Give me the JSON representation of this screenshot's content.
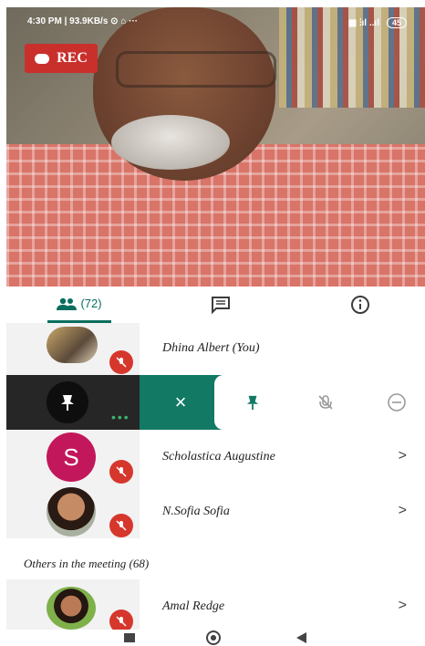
{
  "status_bar": {
    "left": "4:30 PM | 93.9KB/s ⊙ ⌂ ···",
    "right_signal": "▦ ⫶ıl ..ıl",
    "battery": "45"
  },
  "recording": {
    "label": "REC",
    "color": "#c9302c"
  },
  "tabs": {
    "people_count": "(72)",
    "chat_icon": "chat-icon",
    "info_icon": "info-icon",
    "accent": "#0a6e5f"
  },
  "participants": [
    {
      "name": "Dhina Albert (You)",
      "avatar": "photo",
      "muted": true
    },
    {
      "name": "Scholastica Augustine",
      "avatar_letter": "S",
      "avatar_color": "#c2185b",
      "muted": true
    },
    {
      "name": "N.Sofia Sofia",
      "avatar": "photo",
      "muted": true
    }
  ],
  "actions": {
    "close": "×",
    "pin_icon": "pin-icon",
    "mute_icon": "mic-off-icon",
    "remove_icon": "remove-icon",
    "accent": "#127a64"
  },
  "others_section": {
    "title": "Others in the meeting (68)",
    "participants": [
      {
        "name": "Amal Redge",
        "avatar": "photo",
        "muted": true
      }
    ]
  },
  "nav": {
    "items": [
      "recents-icon",
      "home-icon",
      "back-icon"
    ]
  }
}
